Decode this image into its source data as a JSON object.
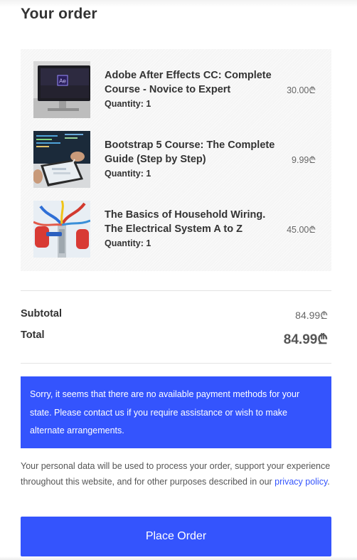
{
  "page": {
    "title": "Your order"
  },
  "items": [
    {
      "name": "Adobe After Effects CC: Complete Course - Novice to Expert",
      "quantity_label": "Quantity:",
      "quantity": "1",
      "price": "30.00₾",
      "thumb_icon": "after-effects-monitor",
      "thumb_text": "Ae"
    },
    {
      "name": "Bootstrap 5 Course: The Complete Guide (Step by Step)",
      "quantity_label": "Quantity:",
      "quantity": "1",
      "price": "9.99₾",
      "thumb_icon": "tablet-coding"
    },
    {
      "name": "The Basics of Household Wiring. The Electrical System A to Z",
      "quantity_label": "Quantity:",
      "quantity": "1",
      "price": "45.00₾",
      "thumb_icon": "electrical-wiring"
    }
  ],
  "totals": {
    "subtotal_label": "Subtotal",
    "subtotal_value": "84.99₾",
    "total_label": "Total",
    "total_value": "84.99₾"
  },
  "notice": {
    "text": "Sorry, it seems that there are no available payment methods for your state. Please contact us if you require assistance or wish to make alternate arrangements."
  },
  "privacy": {
    "text": "Your personal data will be used to process your order, support your experience throughout this website, and for other purposes described in our",
    "link_label": "privacy policy",
    "suffix": "."
  },
  "actions": {
    "place_order_label": "Place Order"
  },
  "colors": {
    "accent": "#3454fd",
    "notice_bg": "#3454fd",
    "items_bg": "#f5f5f5"
  }
}
